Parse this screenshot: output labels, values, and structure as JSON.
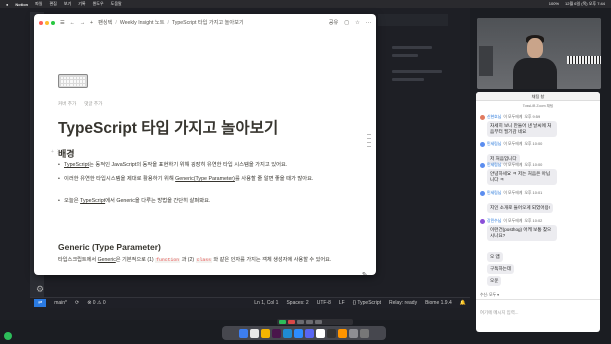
{
  "menubar": {
    "app": "Notion",
    "items": [
      "파일",
      "편집",
      "보기",
      "기록",
      "윈도우",
      "도움말"
    ],
    "status": [
      "100%",
      "12월 6일 (목) 오후 7:44"
    ]
  },
  "notion": {
    "breadcrumb": [
      "팬싱텍",
      "Weekly Insight 노트",
      "TypeScript 타입 가지고 놀아보기"
    ],
    "share_label": "공유",
    "props": [
      "커버 추가",
      "댓글 추가"
    ],
    "title": "TypeScript 타입 가지고 놀아보기",
    "section1": "배경",
    "bullets": [
      {
        "pre": "",
        "link": "TypeScript",
        "post": "는 동적인 JavaScript의 동작을 표현하기 위해 굉장히 유연한 타입 시스템을 가지고 있어요."
      },
      {
        "pre": "이러한 유연한 타입시스템을 제대로 활용하기 위해 ",
        "link": "Generic(Type Parameter)",
        "post": "를 사용할 줄 알면 좋을 때가 많아요."
      },
      {
        "pre": "오늘은 ",
        "link": "TypeScript",
        "post": "에서 Generic을 다루는 방법을 간단히 살펴봐요."
      }
    ],
    "section2": "Generic (Type Parameter)",
    "para_pre": "타입스크립트에서 ",
    "para_link": "Generic",
    "para_mid1": "은 기본적으로 (1) ",
    "code1": "function",
    "para_mid2": " 과 (2) ",
    "code2": "class",
    "para_post": " 와 같은 인자를 가지는 객체 생성자에 사용할 수 있어요."
  },
  "vscode_status": {
    "branch": "main*",
    "sync": "⟳",
    "errors": "⊗ 0  ⚠ 0",
    "position": "Ln 1, Col 1",
    "spaces": "Spaces: 2",
    "encoding": "UTF-8",
    "eol": "LF",
    "lang": "{} TypeScript",
    "relay": "Relay: ready",
    "biome": "Biome 1.9.4"
  },
  "chat": {
    "title": "채팅 창",
    "subtitle": "TossLiB Zoom 채팅",
    "messages": [
      {
        "name": "신현호님",
        "to": "이 모두에게",
        "time": "오후 9:59",
        "text": "자세히 보니 만들어 낸 날씨에 처음부터 필기감 네요",
        "color": "#e07a5f"
      },
      {
        "name": "민세림님",
        "to": "이 모두에게",
        "time": "오후 10:00",
        "text": "저 처음입니다",
        "color": "#5b8def"
      },
      {
        "name": "민세림님",
        "to": "이 모두에게",
        "time": "오후 10:00",
        "text": "안녕하세요 ㅋ 저는 처음은 아닙니다 ㅋ",
        "color": "#5b8def"
      },
      {
        "name": "민세림님",
        "to": "이 모두에게",
        "time": "오후 10:01",
        "text": "지인 소개로 들어오게 되었어용!",
        "color": "#5b8def"
      },
      {
        "name": "강민수님",
        "to": "이 모두에게",
        "time": "오후 10:02",
        "text": "이런건(posthog) 어케 보통 찾으시나요?",
        "color": "#8a4fd8"
      }
    ],
    "shorts": [
      "오 앱",
      "구독하는데",
      "오운"
    ],
    "to_label": "수신: 모두 ▾",
    "input_placeholder": "여기에 메시지 입력..."
  }
}
